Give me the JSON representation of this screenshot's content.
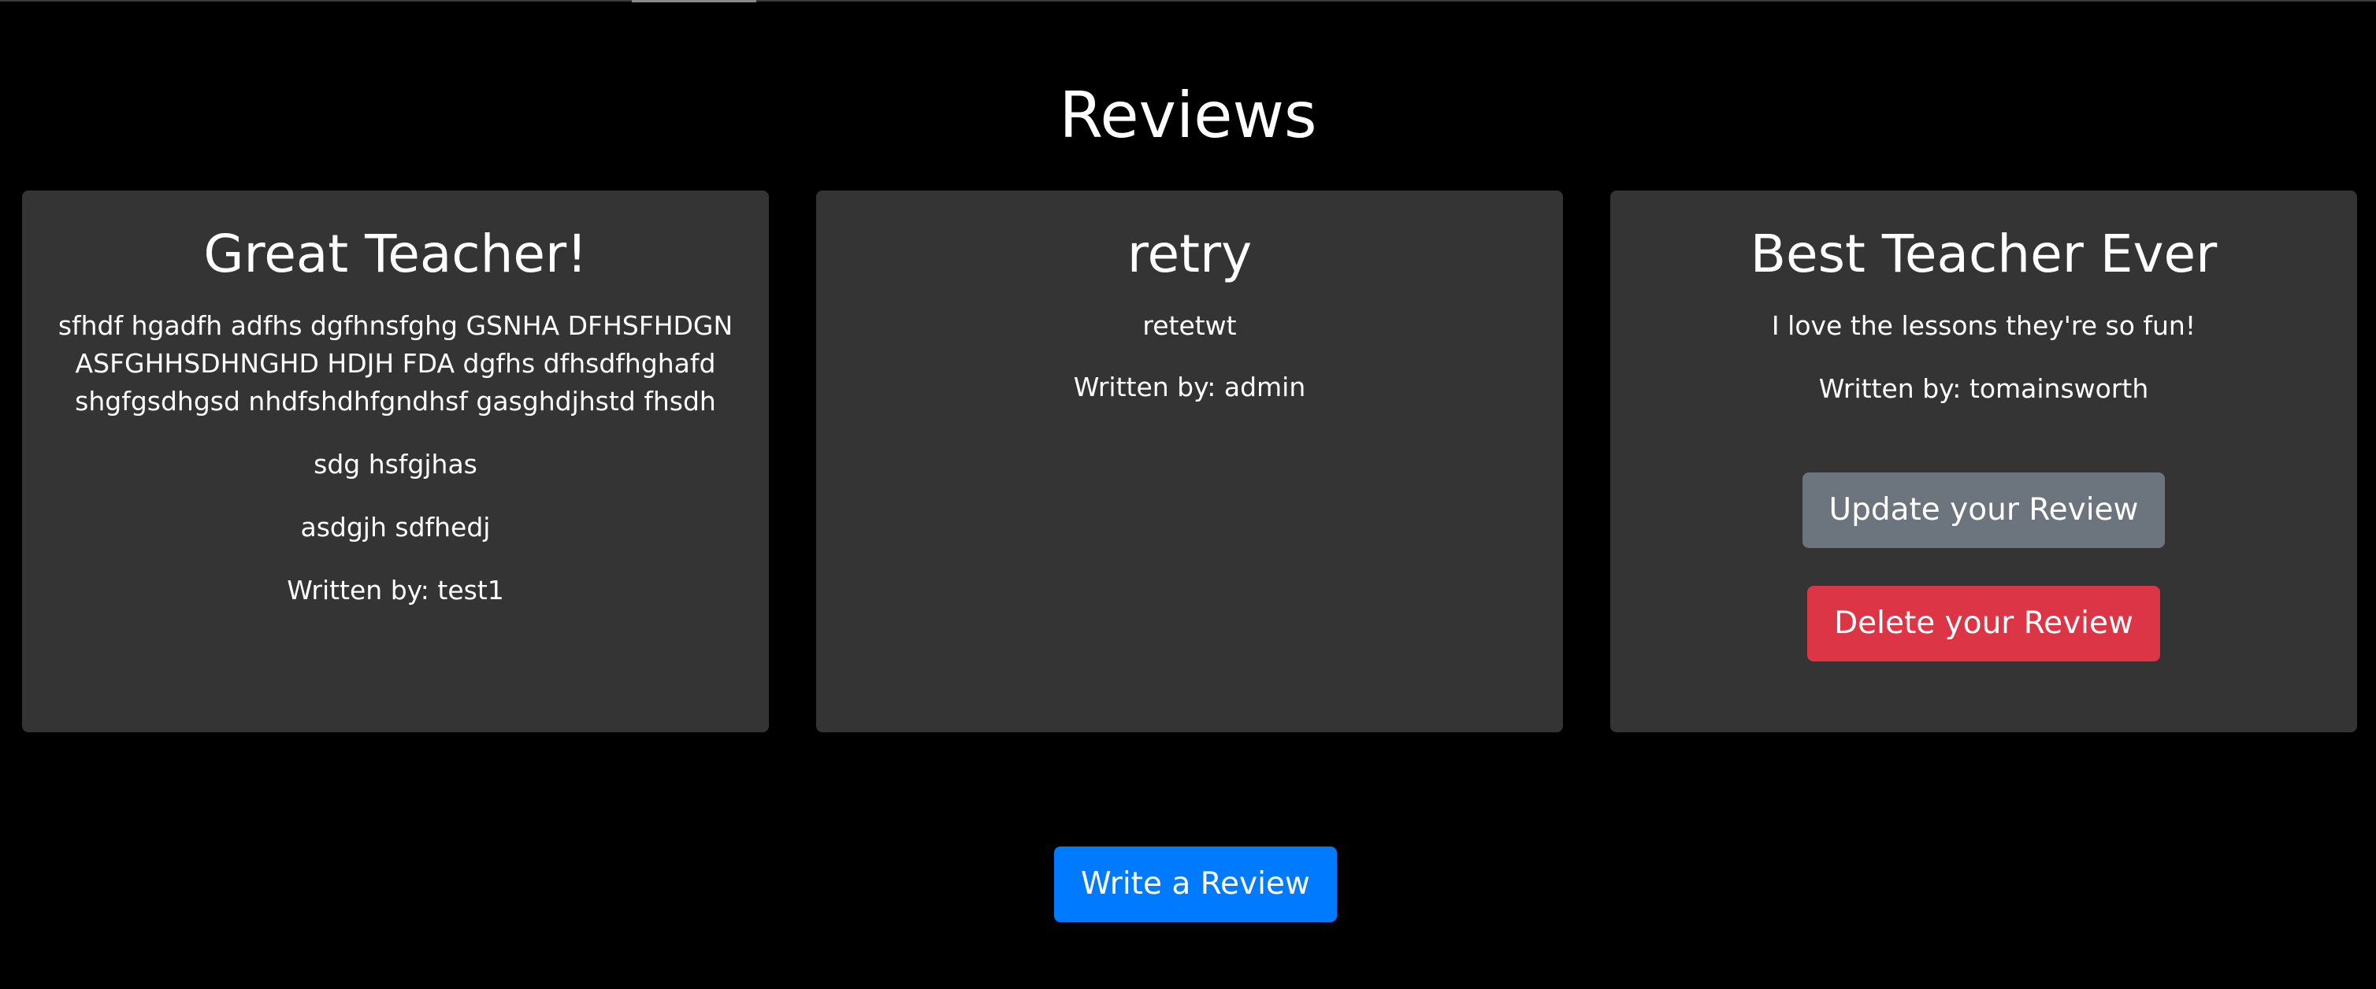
{
  "page": {
    "title": "Reviews"
  },
  "reviews": [
    {
      "title": "Great Teacher!",
      "paragraphs": [
        "sfhdf hgadfh adfhs dgfhnsfghg GSNHA DFHSFHDGN ASFGHHSDHNGHD HDJH FDA dgfhs dfhsdfhghafd shgfgsdhgsd nhdfshdhfgndhsf gasghdjhstd fhsdh",
        "sdg hsfgjhas",
        "asdgjh sdfhedj"
      ],
      "author": "Written by: test1"
    },
    {
      "title": "retry",
      "paragraphs": [
        "retetwt"
      ],
      "author": "Written by: admin"
    },
    {
      "title": "Best Teacher Ever",
      "paragraphs": [
        "I love the lessons they're so fun!"
      ],
      "author": "Written by: tomainsworth",
      "actions": {
        "update_label": "Update your Review",
        "delete_label": "Delete your Review"
      }
    }
  ],
  "footer": {
    "write_label": "Write a Review"
  },
  "colors": {
    "background": "#000000",
    "card": "#343434",
    "update": "#6c757d",
    "delete": "#dc3545",
    "primary": "#007bff"
  }
}
